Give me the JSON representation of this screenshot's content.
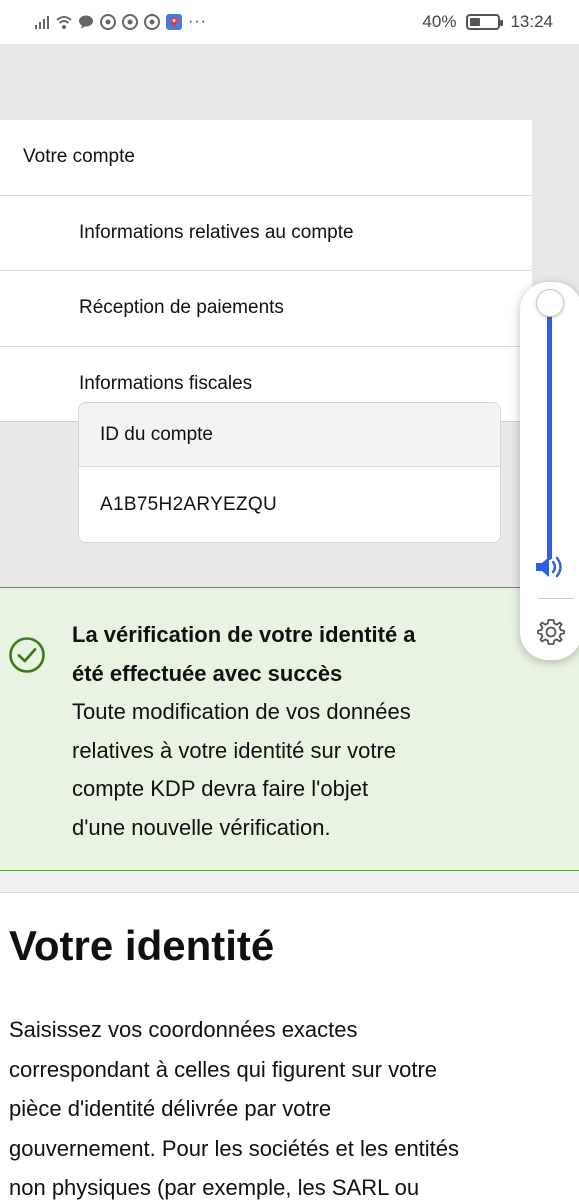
{
  "status_bar": {
    "battery_percent": "40%",
    "time": "13:24",
    "battery_level": 0.4,
    "icons": [
      "signal-icon",
      "wifi-icon",
      "chat-icon",
      "chrome-icon",
      "chrome-icon",
      "chrome-icon",
      "maps-icon",
      "more-icon"
    ]
  },
  "menu": {
    "section_title": "Votre compte",
    "items": [
      {
        "label": "Informations relatives au compte"
      },
      {
        "label": "Réception de paiements"
      },
      {
        "label": "Informations fiscales"
      }
    ]
  },
  "account_id": {
    "header": "ID du compte",
    "value": "A1B75H2ARYEZQU"
  },
  "alert": {
    "title_line1": "La vérification de votre identité a",
    "title_line2": "été effectuée avec succès",
    "body_lines": [
      "Toute modification de vos données",
      "relatives à votre identité sur votre",
      "compte KDP devra faire l'objet",
      "d'une nouvelle vérification."
    ],
    "accent_color": "#3c7a1e"
  },
  "identity": {
    "title": "Votre identité",
    "desc_lines": [
      "Saisissez vos coordonnées exactes",
      "correspondant à celles qui figurent sur votre",
      "pièce d'identité délivrée par votre",
      "gouvernement. Pour les sociétés et les entités",
      "non physiques (par exemple, les SARL ou"
    ]
  },
  "volume_panel": {
    "level": 1.0,
    "accent_color": "#2f5fe0"
  }
}
